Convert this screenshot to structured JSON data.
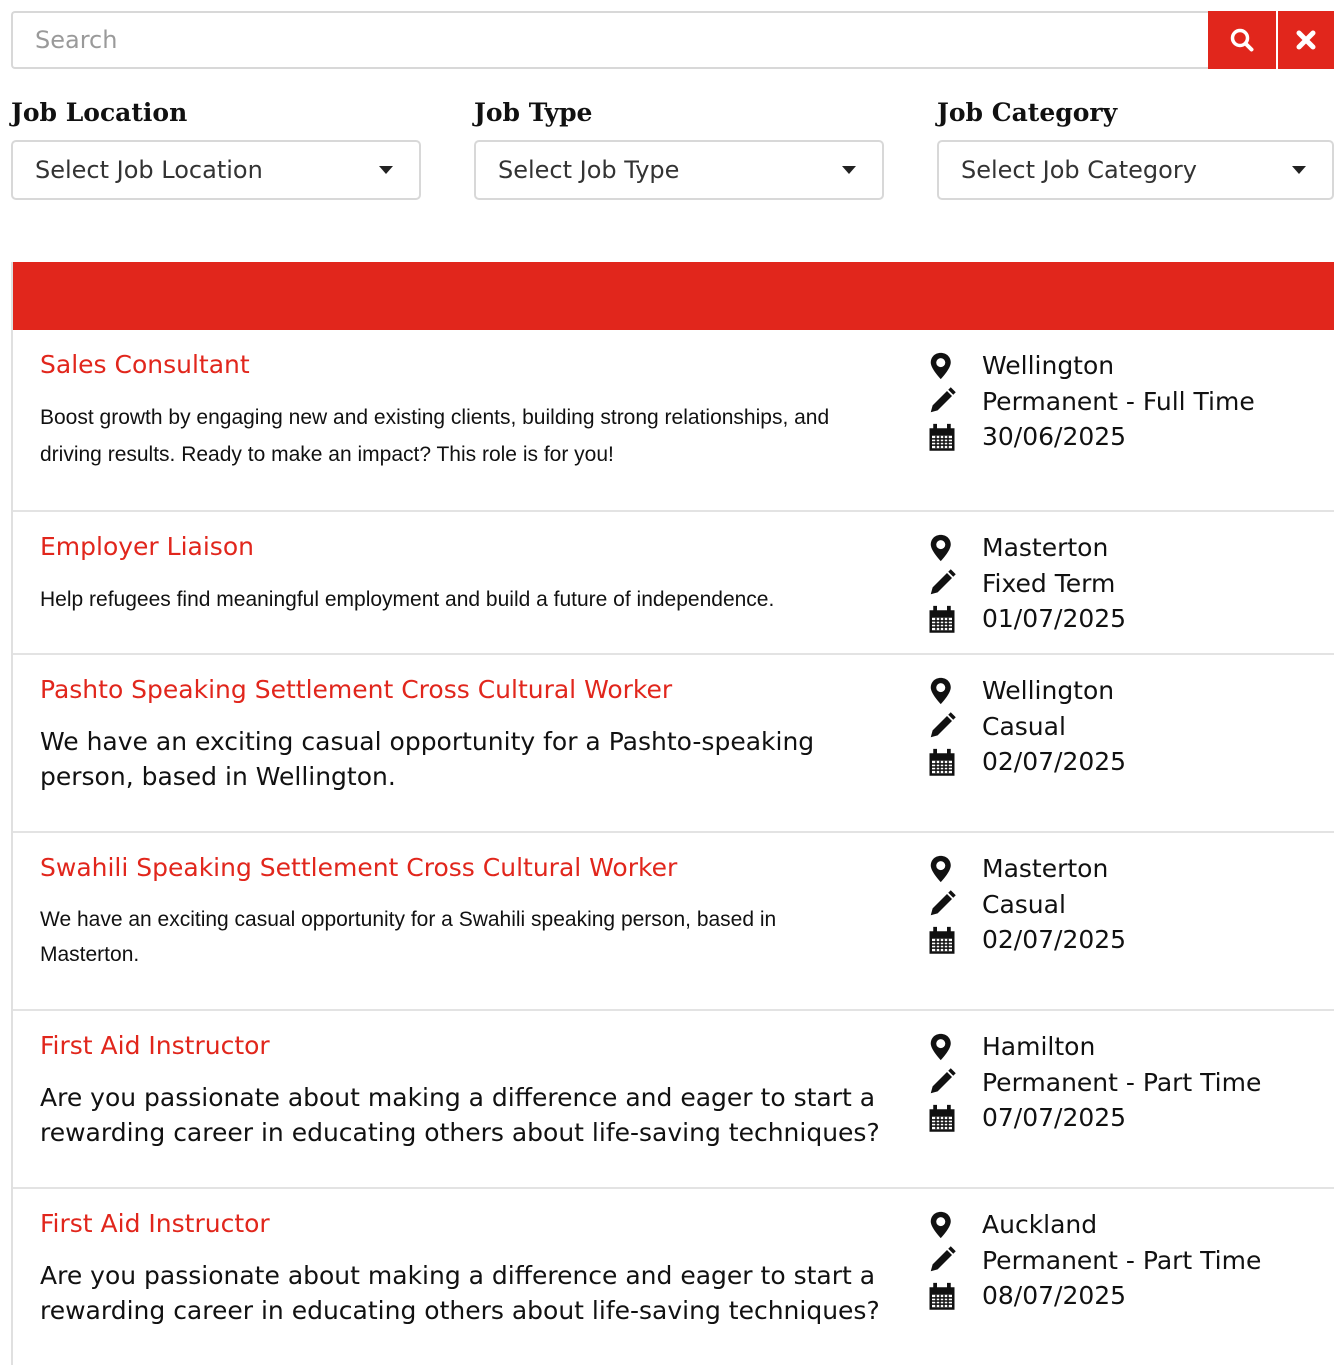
{
  "search": {
    "placeholder": "Search",
    "value": ""
  },
  "filters": [
    {
      "label": "Job Location",
      "selected": "Select Job Location"
    },
    {
      "label": "Job Type",
      "selected": "Select Job Type"
    },
    {
      "label": "Job Category",
      "selected": "Select Job Category"
    }
  ],
  "colors": {
    "accent": "#e1261c",
    "title_link": "#e1261c",
    "text": "#111111"
  },
  "icons": {
    "search_button": "search-icon",
    "clear_button": "close-icon",
    "location": "map-marker-icon",
    "type": "pencil-icon",
    "date": "calendar-icon"
  },
  "jobs": [
    {
      "title": "Sales Consultant",
      "description": "Boost growth by engaging new and existing clients, building strong relationships, and driving results. Ready to make an impact? This role is for you!",
      "location": "Wellington",
      "type": "Permanent - Full Time",
      "date": "30/06/2025"
    },
    {
      "title": "Employer Liaison",
      "description": "Help refugees find meaningful employment and build a future of independence.",
      "location": "Masterton",
      "type": "Fixed Term",
      "date": "01/07/2025"
    },
    {
      "title": "Pashto Speaking Settlement Cross Cultural Worker",
      "description": "We have an exciting casual opportunity for a Pashto-speaking person, based in Wellington.",
      "location": "Wellington",
      "type": "Casual",
      "date": "02/07/2025"
    },
    {
      "title": "Swahili Speaking Settlement Cross Cultural Worker",
      "description": "We have an exciting casual opportunity for a Swahili speaking person, based in Masterton.",
      "location": "Masterton",
      "type": "Casual",
      "date": "02/07/2025"
    },
    {
      "title": "First Aid Instructor",
      "description": "Are you passionate about making a difference and eager to start a rewarding career in educating others about life-saving techniques?",
      "location": "Hamilton",
      "type": "Permanent - Part Time",
      "date": "07/07/2025"
    },
    {
      "title": "First Aid Instructor",
      "description": "Are you passionate about making a difference and eager to start a rewarding career in educating others about life-saving techniques?",
      "location": "Auckland",
      "type": "Permanent - Part Time",
      "date": "08/07/2025"
    }
  ]
}
